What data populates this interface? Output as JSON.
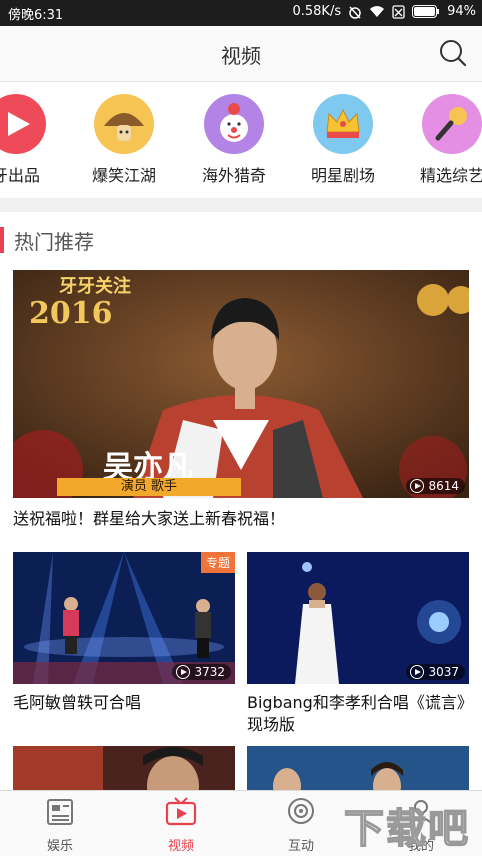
{
  "status_bar": {
    "time": "傍晚6:31",
    "network_speed": "0.58K/s",
    "battery": "94%"
  },
  "header": {
    "title": "视频"
  },
  "categories": [
    {
      "label": "牙出品",
      "color": "#ef4a5a",
      "icon": "play-icon"
    },
    {
      "label": "爆笑江湖",
      "color": "#f5c453",
      "icon": "mushroom-icon"
    },
    {
      "label": "海外猎奇",
      "color": "#b383e6",
      "icon": "clown-icon"
    },
    {
      "label": "明星剧场",
      "color": "#7fc8ef",
      "icon": "crown-icon"
    },
    {
      "label": "精选综艺",
      "color": "#e48fe4",
      "icon": "microphone-icon"
    }
  ],
  "section": {
    "title": "热门推荐"
  },
  "featured": {
    "overlay_year": "2016",
    "overlay_banner": "牙牙关注",
    "name_plate": "吴亦凡",
    "role_plate": "演员  歌手",
    "views": "8614",
    "caption": "送祝福啦！群星给大家送上新春祝福！"
  },
  "videos": [
    {
      "caption": "毛阿敏曾轶可合唱",
      "views": "3732",
      "tag": "专题"
    },
    {
      "caption": "Bigbang和李孝利合唱《谎言》现场版",
      "views": "3037",
      "tag": ""
    }
  ],
  "tabs": [
    {
      "label": "娱乐",
      "icon": "news-icon",
      "active": false
    },
    {
      "label": "视频",
      "icon": "tv-icon",
      "active": true
    },
    {
      "label": "互动",
      "icon": "interaction-icon",
      "active": false
    },
    {
      "label": "我的",
      "icon": "profile-icon",
      "active": false
    }
  ],
  "watermark": "下载吧",
  "colors": {
    "accent": "#e8414f"
  }
}
